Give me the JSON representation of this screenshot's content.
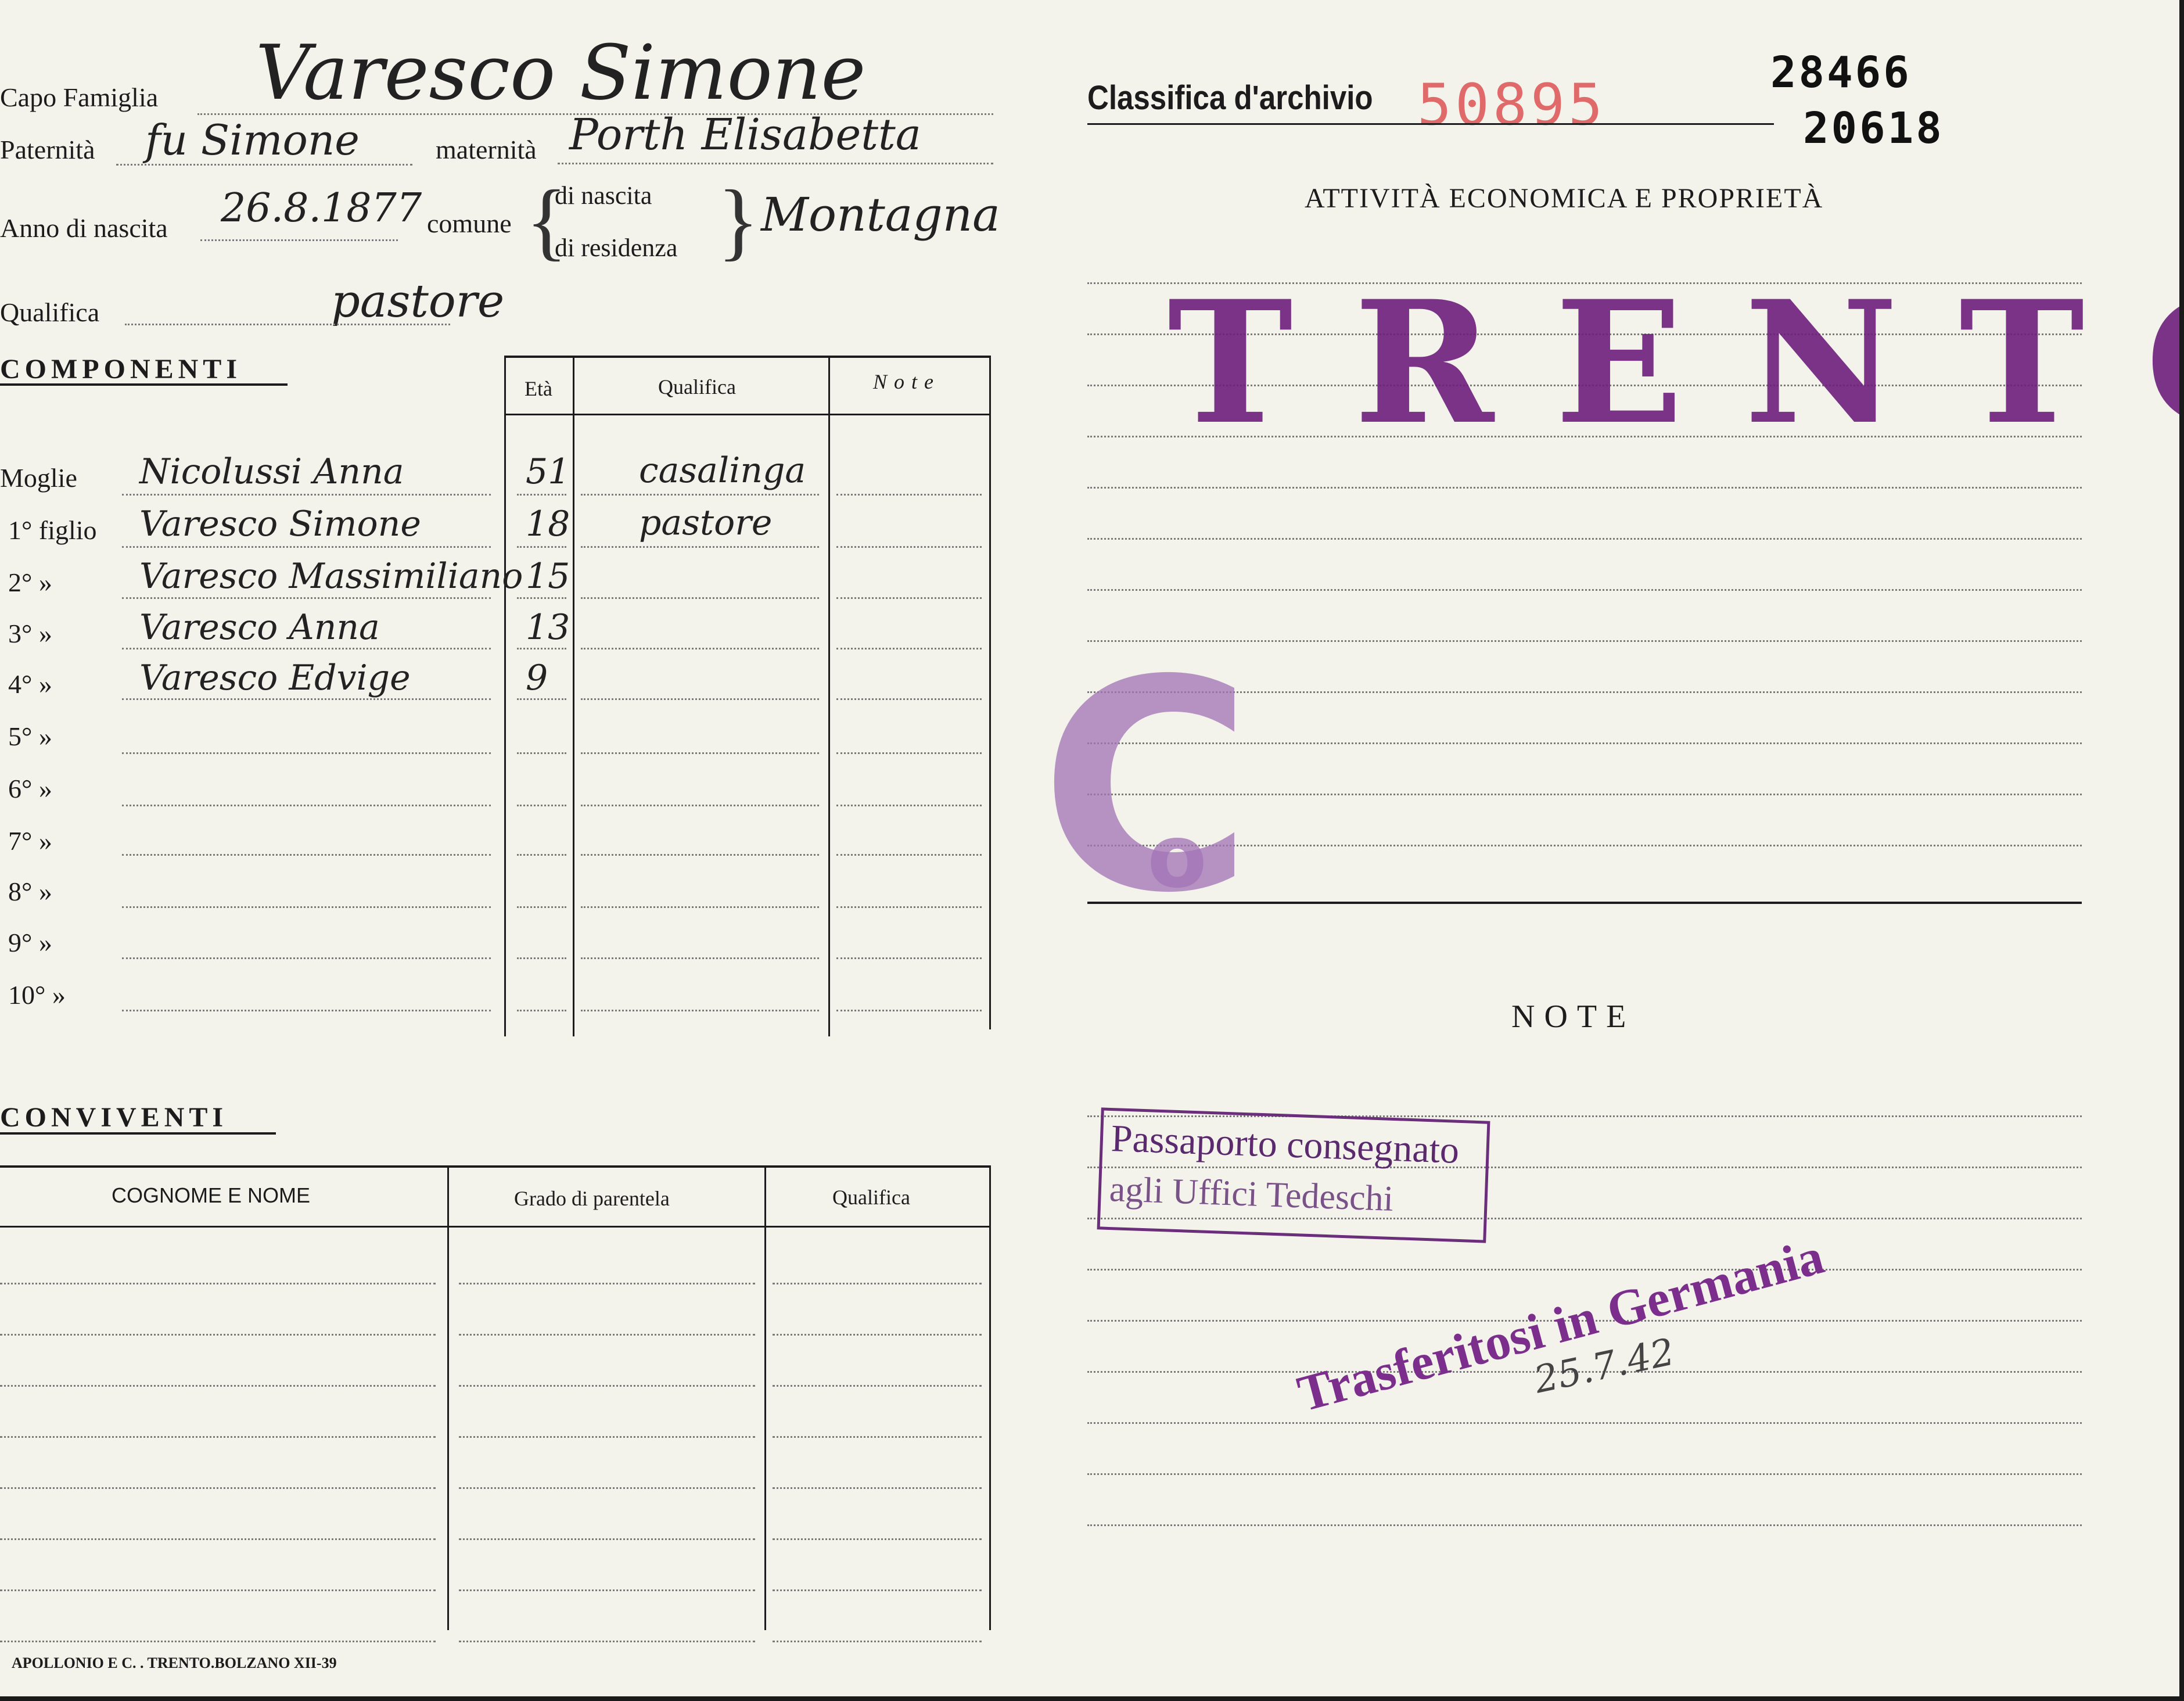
{
  "header": {
    "capo_famiglia_label": "Capo Famiglia",
    "capo_famiglia_value": "Varesco Simone",
    "paternita_label": "Paternità",
    "paternita_value": "fu Simone",
    "maternita_label": "maternità",
    "maternita_value": "Porth Elisabetta",
    "anno_label": "Anno di nascita",
    "anno_value": "26.8.1877",
    "comune_label": "comune",
    "di_nascita_label": "di nascita",
    "di_residenza_label": "di residenza",
    "comune_value": "Montagna",
    "qualifica_label": "Qualifica",
    "qualifica_value": "pastore"
  },
  "componenti": {
    "title": "COMPONENTI",
    "col_eta": "Età",
    "col_qualifica": "Qualifica",
    "col_note": "Note",
    "rows": [
      {
        "label": "Moglie",
        "name": "Nicolussi Anna",
        "eta": "51",
        "qualifica": "casalinga"
      },
      {
        "label": "1° figlio",
        "name": "Varesco Simone",
        "eta": "18",
        "qualifica": "pastore"
      },
      {
        "label": "2°  »",
        "name": "Varesco Massimiliano",
        "eta": "15",
        "qualifica": ""
      },
      {
        "label": "3°  »",
        "name": "Varesco Anna",
        "eta": "13",
        "qualifica": ""
      },
      {
        "label": "4°  »",
        "name": "Varesco Edvige",
        "eta": "9",
        "qualifica": ""
      },
      {
        "label": "5°  »",
        "name": "",
        "eta": "",
        "qualifica": ""
      },
      {
        "label": "6°  »",
        "name": "",
        "eta": "",
        "qualifica": ""
      },
      {
        "label": "7°  »",
        "name": "",
        "eta": "",
        "qualifica": ""
      },
      {
        "label": "8°  »",
        "name": "",
        "eta": "",
        "qualifica": ""
      },
      {
        "label": "9°  »",
        "name": "",
        "eta": "",
        "qualifica": ""
      },
      {
        "label": "10°  »",
        "name": "",
        "eta": "",
        "qualifica": ""
      }
    ]
  },
  "conviventi": {
    "title": "CONVIVENTI",
    "col_nome": "COGNOME E NOME",
    "col_grado": "Grado di parentela",
    "col_qualifica": "Qualifica"
  },
  "archive": {
    "classifica_label": "Classifica d'archivio",
    "classifica_value": "50895",
    "number_1": "28466",
    "number_2": "20618"
  },
  "attivita": {
    "title": "ATTIVITÀ ECONOMICA E PROPRIETÀ",
    "stamp_city": "TRENTO",
    "stamp_letter": "C",
    "stamp_letter_small": "o"
  },
  "note": {
    "title": "NOTE",
    "passaporto_line1": "Passaporto consegnato",
    "passaporto_line2": "agli Uffici Tedeschi",
    "trasferitosi": "Trasferitosi in Germania",
    "date": "25.7.42"
  },
  "footer": {
    "printer": "APOLLONIO E C. . TRENTO.BOLZANO XII-39"
  },
  "colors": {
    "paper": "#f3f3ec",
    "stamp_purple": "#6d1f7c",
    "archive_red": "#e06a6a"
  }
}
